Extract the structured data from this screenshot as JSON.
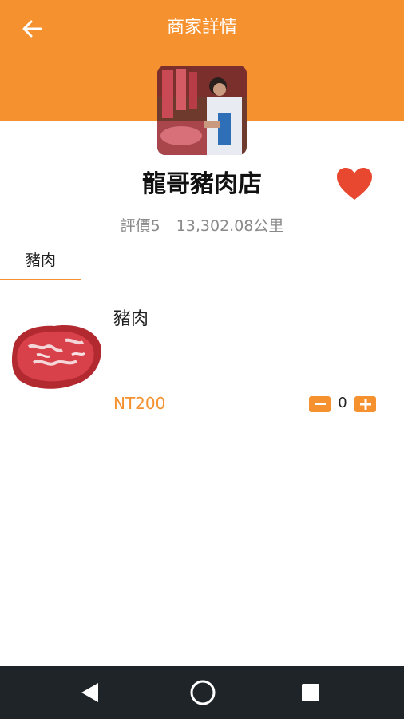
{
  "header": {
    "title": "商家詳情"
  },
  "store": {
    "name": "龍哥豬肉店",
    "rating": "評價5",
    "distance": "13,302.08公里",
    "favorited": true
  },
  "tabs": [
    {
      "label": "豬肉",
      "active": true
    }
  ],
  "products": [
    {
      "name": "豬肉",
      "price": "NT200",
      "quantity": "0"
    }
  ],
  "colors": {
    "accent": "#F5912F",
    "heart": "#E8482F",
    "navbar": "#1F2429"
  },
  "icons": [
    "back-arrow-icon",
    "heart-icon",
    "minus-icon",
    "plus-icon",
    "nav-back-icon",
    "nav-home-icon",
    "nav-recents-icon"
  ]
}
